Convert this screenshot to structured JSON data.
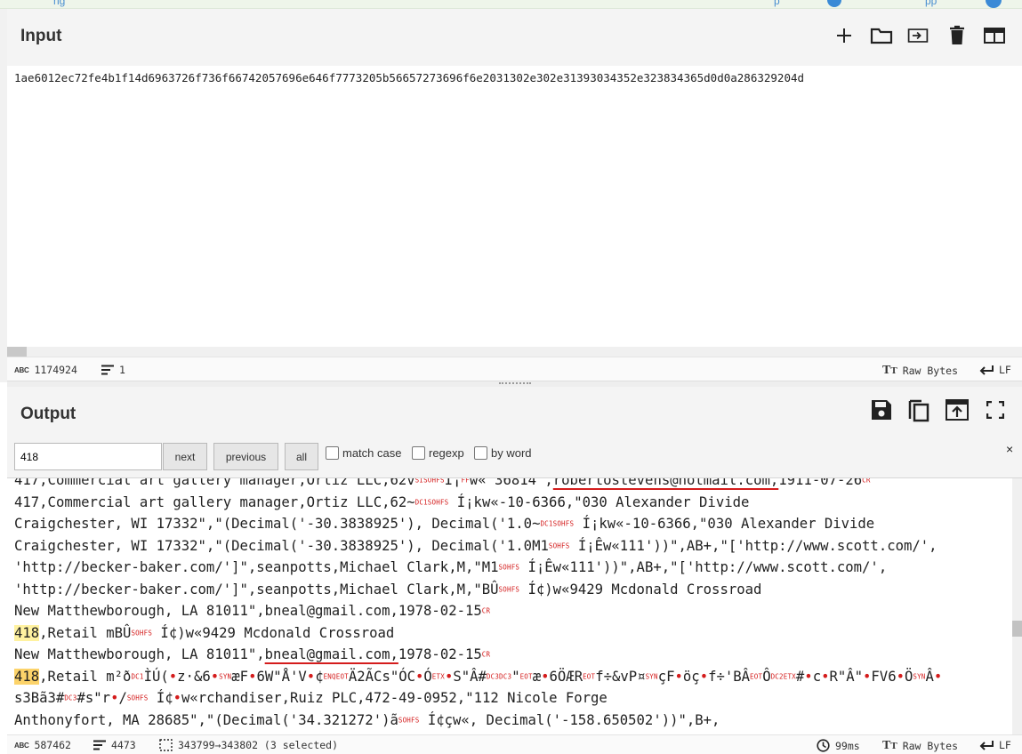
{
  "top_nav": {
    "left_link": "ng",
    "mid_link": "p",
    "right_link": "pp"
  },
  "input_panel": {
    "title": "Input",
    "text": "1ae6012ec72fe4b1f14d6963726f736f66742057696e646f7773205b56657273696f6e2031302e302e31393034352e323834365d0d0a286329204d",
    "status": {
      "length": "1174924",
      "lines": "1",
      "encoding": "Raw Bytes",
      "eol": "LF"
    },
    "toolbar": [
      "add-icon",
      "folder-icon",
      "import-icon",
      "trash-icon",
      "layout-icon"
    ]
  },
  "output_panel": {
    "title": "Output",
    "toolbar": [
      "save-icon",
      "copy-icon",
      "upload-icon",
      "fullscreen-icon"
    ],
    "search": {
      "value": "418",
      "next_label": "next",
      "previous_label": "previous",
      "all_label": "all",
      "match_case_label": "match case",
      "regexp_label": "regexp",
      "by_word_label": "by word",
      "close": "×"
    },
    "lines": [
      [
        {
          "t": "417,Commercial art gallery manager,Ortiz LLC,62v"
        },
        {
          "t": "SI",
          "c": "ctl"
        },
        {
          "t": "SOH",
          "c": "ctl"
        },
        {
          "t": "FS",
          "c": "ctl"
        },
        {
          "t": "Í¡"
        },
        {
          "t": "FF",
          "c": "ctl"
        },
        {
          "t": "w« 36814\","
        },
        {
          "t": "robertostevens@hotmail.com,",
          "c": "ul"
        },
        {
          "t": "1911-07-26"
        },
        {
          "t": "CR",
          "c": "ctl"
        }
      ],
      [
        {
          "t": "417,Commercial art gallery manager,Ortiz LLC,62~"
        },
        {
          "t": "DC1",
          "c": "ctl"
        },
        {
          "t": "SOH",
          "c": "ctl"
        },
        {
          "t": "FS",
          "c": "ctl"
        },
        {
          "t": " Í¡kw«-10-6366,\"030 Alexander Divide"
        }
      ],
      [
        {
          "t": "Craigchester, WI 17332\",\"(Decimal('-30.3838925'), Decimal('1.0~"
        },
        {
          "t": "DC1",
          "c": "ctl"
        },
        {
          "t": "SOH",
          "c": "ctl"
        },
        {
          "t": "FS",
          "c": "ctl"
        },
        {
          "t": " Í¡kw«-10-6366,\"030 Alexander Divide"
        }
      ],
      [
        {
          "t": "Craigchester, WI 17332\",\"(Decimal('-30.3838925'), Decimal('1.0M1"
        },
        {
          "t": "SOH",
          "c": "ctl"
        },
        {
          "t": "FS",
          "c": "ctl"
        },
        {
          "t": " Í¡Êw«111'))\",AB+,\"['http://www.scott.com/',"
        }
      ],
      [
        {
          "t": "'http://becker-baker.com/']\",seanpotts,Michael Clark,M,\"M1"
        },
        {
          "t": "SOH",
          "c": "ctl"
        },
        {
          "t": "FS",
          "c": "ctl"
        },
        {
          "t": " Í¡Êw«111'))\",AB+,\"['http://www.scott.com/',"
        }
      ],
      [
        {
          "t": "'http://becker-baker.com/']\",seanpotts,Michael Clark,M,\"BÛ"
        },
        {
          "t": "SOH",
          "c": "ctl"
        },
        {
          "t": "FS",
          "c": "ctl"
        },
        {
          "t": " Í¢)w«9429 Mcdonald Crossroad"
        }
      ],
      [
        {
          "t": "New Matthewborough, LA 81011\",bneal@gmail.com,1978-02-15"
        },
        {
          "t": "CR",
          "c": "ctl"
        }
      ],
      [
        {
          "t": "418",
          "c": "hl"
        },
        {
          "t": ",Retail mBÛ"
        },
        {
          "t": "SOH",
          "c": "ctl"
        },
        {
          "t": "FS",
          "c": "ctl"
        },
        {
          "t": " Í¢)w«9429 Mcdonald Crossroad"
        }
      ],
      [
        {
          "t": "New Matthewborough, LA 81011\","
        },
        {
          "t": "bneal@gmail.com,",
          "c": "ul"
        },
        {
          "t": "1978-02-15"
        },
        {
          "t": "CR",
          "c": "ctl"
        }
      ],
      [
        {
          "t": "418",
          "c": "hlc"
        },
        {
          "t": ",Retail m²ð"
        },
        {
          "t": "DC1",
          "c": "ctl"
        },
        {
          "t": "ÌÚ("
        },
        {
          "t": "•",
          "c": "dot"
        },
        {
          "t": "z·&6"
        },
        {
          "t": "•",
          "c": "dot"
        },
        {
          "t": "SYN",
          "c": "ctl"
        },
        {
          "t": "æF"
        },
        {
          "t": "•",
          "c": "dot"
        },
        {
          "t": "6W\"Å'V"
        },
        {
          "t": "•",
          "c": "dot"
        },
        {
          "t": "¢"
        },
        {
          "t": "ENQ",
          "c": "ctl"
        },
        {
          "t": "EOT",
          "c": "ctl"
        },
        {
          "t": "Ä2ÃCs\"ÓC"
        },
        {
          "t": "•",
          "c": "dot"
        },
        {
          "t": "Ó"
        },
        {
          "t": "ETX",
          "c": "ctl"
        },
        {
          "t": "•",
          "c": "dot"
        },
        {
          "t": "S\"Â#"
        },
        {
          "t": "DC3",
          "c": "ctl"
        },
        {
          "t": "DC3",
          "c": "ctl"
        },
        {
          "t": "\""
        },
        {
          "t": "EOT",
          "c": "ctl"
        },
        {
          "t": "æ"
        },
        {
          "t": "•",
          "c": "dot"
        },
        {
          "t": "6ÖÆR"
        },
        {
          "t": "EOT",
          "c": "ctl"
        },
        {
          "t": "f÷&vP¤"
        },
        {
          "t": "SYN",
          "c": "ctl"
        },
        {
          "t": "çF"
        },
        {
          "t": "•",
          "c": "dot"
        },
        {
          "t": "öç"
        },
        {
          "t": "•",
          "c": "dot"
        },
        {
          "t": "f÷'BÂ"
        },
        {
          "t": "EOT",
          "c": "ctl"
        },
        {
          "t": "Ô"
        },
        {
          "t": "DC2",
          "c": "ctl"
        },
        {
          "t": "ETX",
          "c": "ctl"
        },
        {
          "t": "#"
        },
        {
          "t": "•",
          "c": "dot"
        },
        {
          "t": "c"
        },
        {
          "t": "•",
          "c": "dot"
        },
        {
          "t": "R\"Â\""
        },
        {
          "t": "•",
          "c": "dot"
        },
        {
          "t": "FV6"
        },
        {
          "t": "•",
          "c": "dot"
        },
        {
          "t": "Ö"
        },
        {
          "t": "SYN",
          "c": "ctl"
        },
        {
          "t": "Â"
        },
        {
          "t": "•",
          "c": "dot"
        }
      ],
      [
        {
          "t": "s3Bã3#"
        },
        {
          "t": "DC3",
          "c": "ctl"
        },
        {
          "t": "#s\"r"
        },
        {
          "t": "•",
          "c": "dot"
        },
        {
          "t": "/"
        },
        {
          "t": "SOH",
          "c": "ctl"
        },
        {
          "t": "FS",
          "c": "ctl"
        },
        {
          "t": " Í¢"
        },
        {
          "t": "•",
          "c": "dot"
        },
        {
          "t": "w«rchandiser,Ruiz PLC,472-49-0952,\"112 Nicole Forge"
        }
      ],
      [
        {
          "t": "Anthonyfort, MA 28685\",\"(Decimal('34.321272')ã"
        },
        {
          "t": "SOH",
          "c": "ctl"
        },
        {
          "t": "FS",
          "c": "ctl"
        },
        {
          "t": " Í¢çw«, Decimal('-158.650502'))\",B+,"
        }
      ]
    ],
    "status": {
      "length": "587462",
      "lines": "4473",
      "selection": "343799→343802 (3 selected)",
      "time": "99ms",
      "encoding": "Raw Bytes",
      "eol": "LF"
    }
  },
  "colors": {
    "control_char": "#d41c1c",
    "highlight": "#fff2a0",
    "current_match": "#fcd36a",
    "panel_bg": "#f4f4f4"
  }
}
